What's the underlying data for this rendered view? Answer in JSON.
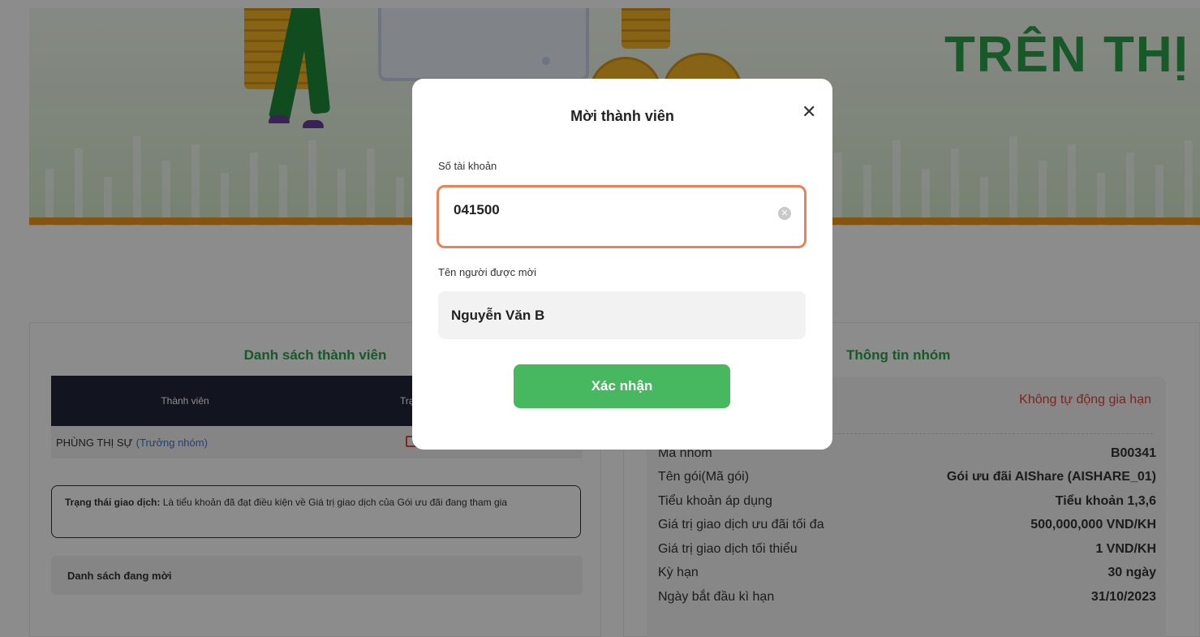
{
  "banner": {
    "title": "TRÊN THỊ TR"
  },
  "members_panel": {
    "title": "Danh sách thành viên",
    "columns": [
      "Thành viên",
      "Trạ"
    ],
    "rows": [
      {
        "name": "PHÙNG THỊ SỰ",
        "role": "(Trưởng nhóm)"
      }
    ],
    "note_label": "Trạng thái giao dịch:",
    "note_text": "Là tiểu khoản đã đạt điều kiện về Giá trị giao dịch của Gói ưu đãi đang tham gia",
    "invite_list_label": "Danh sách đang mời"
  },
  "group_panel": {
    "title": "Thông tin nhóm",
    "renew_status": "Không tự động gia hạn",
    "rows": [
      {
        "label": "Mã nhóm",
        "value": "B00341"
      },
      {
        "label": "Tên gói(Mã gói)",
        "value": "Gói ưu đãi AIShare (AISHARE_01)"
      },
      {
        "label": "Tiểu khoản áp dụng",
        "value": "Tiểu khoản 1,3,6"
      },
      {
        "label": "Giá trị giao dịch ưu đãi tối đa",
        "value": "500,000,000 VND/KH"
      },
      {
        "label": "Giá trị giao dịch tối thiểu",
        "value": "1 VND/KH"
      },
      {
        "label": "Kỳ hạn",
        "value": "30 ngày"
      },
      {
        "label": "Ngày bắt đầu kì hạn",
        "value": "31/10/2023"
      }
    ]
  },
  "modal": {
    "title": "Mời thành viên",
    "account_label": "Số tài khoản",
    "account_value": "041500",
    "invitee_label": "Tên người được mời",
    "invitee_name": "Nguyễn Văn B",
    "confirm_label": "Xác nhận"
  },
  "colors": {
    "accent_green": "#2aa24a",
    "button_green": "#47b760",
    "focus_orange": "#e9825b",
    "alert_red": "#e2463b",
    "table_header": "#22263a"
  },
  "icons": {
    "close": "close-icon",
    "clear": "clear-input-icon",
    "mail": "mail-icon"
  }
}
